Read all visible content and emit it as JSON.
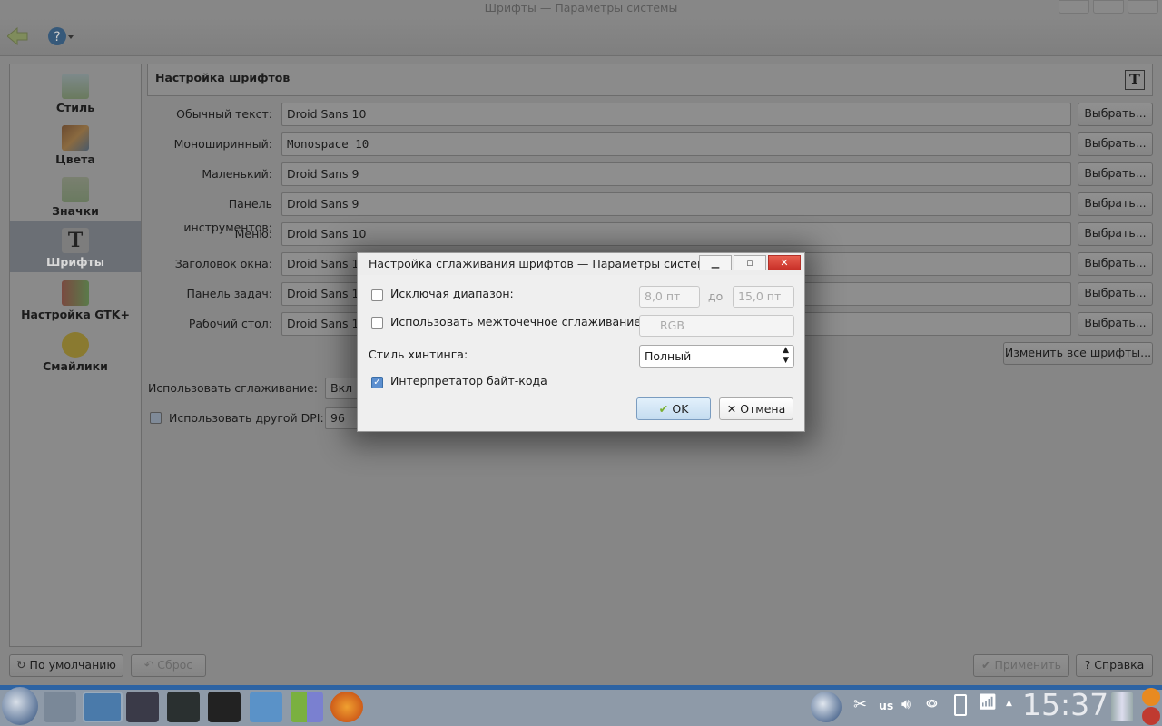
{
  "window": {
    "title": "Шрифты — Параметры системы"
  },
  "sidebar": {
    "items": [
      {
        "label": "Стиль"
      },
      {
        "label": "Цвета"
      },
      {
        "label": "Значки"
      },
      {
        "label": "Шрифты",
        "selected": true
      },
      {
        "label": "Настройка GTK+"
      },
      {
        "label": "Смайлики"
      }
    ]
  },
  "header": {
    "title": "Настройка шрифтов"
  },
  "fonts": [
    {
      "label": "Обычный текст:",
      "value": "Droid Sans 10"
    },
    {
      "label": "Моноширинный:",
      "value": "Monospace 10"
    },
    {
      "label": "Маленький:",
      "value": "Droid Sans 9"
    },
    {
      "label": "Панель инструментов:",
      "value": "Droid Sans 9"
    },
    {
      "label": "Меню:",
      "value": "Droid Sans 10"
    },
    {
      "label": "Заголовок окна:",
      "value": "Droid Sans 10"
    },
    {
      "label": "Панель задач:",
      "value": "Droid Sans 10"
    },
    {
      "label": "Рабочий стол:",
      "value": "Droid Sans 10"
    }
  ],
  "choose_label": "Выбрать...",
  "change_all_label": "Изменить все шрифты...",
  "antialias": {
    "label": "Использовать сглаживание:",
    "value": "Вкл"
  },
  "dpi": {
    "label": "Использовать другой DPI:",
    "value": "96",
    "checked": true
  },
  "bottom": {
    "defaults": "По умолчанию",
    "reset": "Сброс",
    "apply": "Применить",
    "help": "Справка"
  },
  "dialog": {
    "title": "Настройка сглаживания шрифтов — Параметры системы",
    "exclude_label": "Исключая диапазон:",
    "exclude_checked": false,
    "from": "8,0 пт",
    "to_label": "до",
    "to": "15,0 пт",
    "subpixel_label": "Использовать межточечное сглаживание:",
    "subpixel_checked": false,
    "subpixel_value": "RGB",
    "hinting_label": "Стиль хинтинга:",
    "hinting_value": "Полный",
    "bytecode_label": "Интерпретатор байт-кода",
    "bytecode_checked": true,
    "ok": "OK",
    "cancel": "Отмена"
  },
  "tray": {
    "layout": "us",
    "clock": "15:37"
  }
}
